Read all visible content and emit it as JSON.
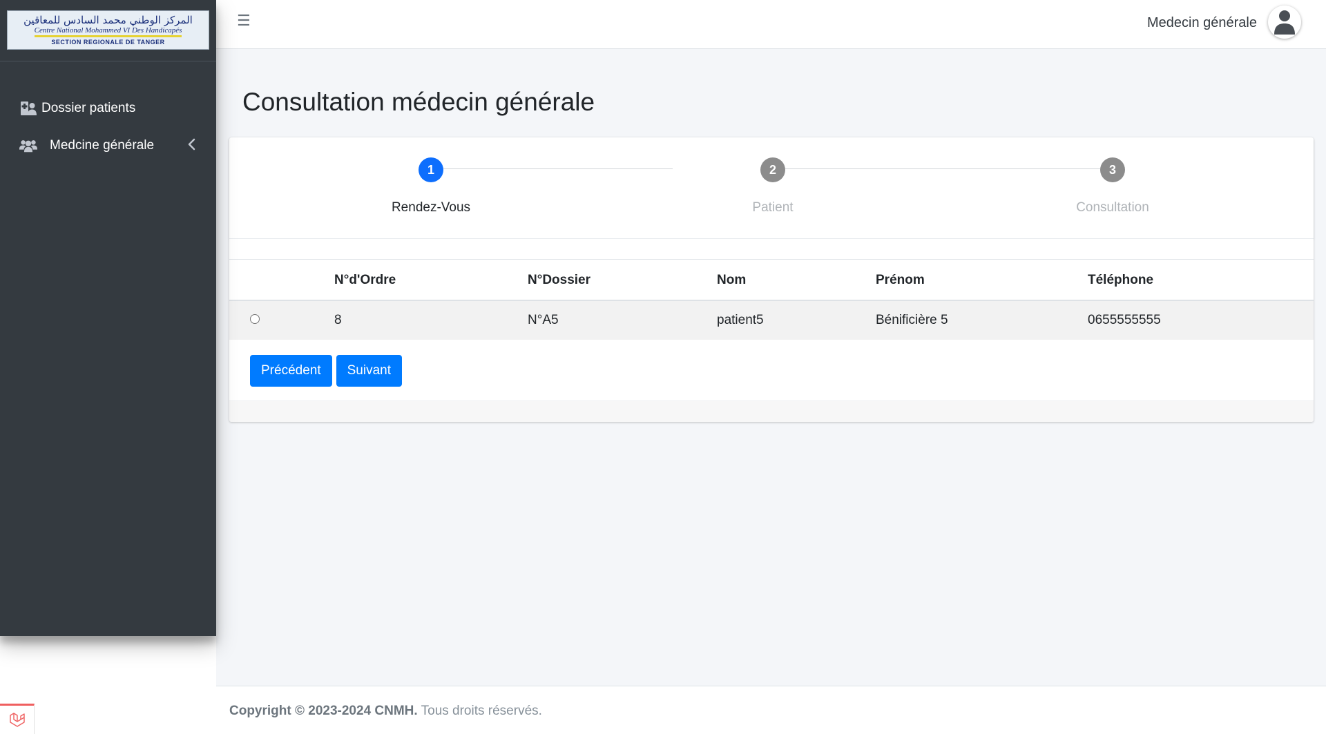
{
  "brand": {
    "logo_arabic": "المركز الوطني محمد السادس للمعاقين",
    "logo_french": "Centre National Mohammed VI Des Handicapés",
    "logo_section": "SECTION REGIONALE DE TANGER"
  },
  "sidebar": {
    "items": [
      {
        "label": "Dossier patients",
        "icon": "hospital-user-icon"
      },
      {
        "label": "Medcine générale",
        "icon": "users-icon"
      }
    ]
  },
  "header": {
    "menu_icon": "☰",
    "user_name": "Medecin générale"
  },
  "page": {
    "title": "Consultation médecin générale"
  },
  "stepper": {
    "steps": [
      {
        "number": "1",
        "label": "Rendez-Vous",
        "active": true
      },
      {
        "number": "2",
        "label": "Patient",
        "active": false
      },
      {
        "number": "3",
        "label": "Consultation",
        "active": false
      }
    ]
  },
  "table": {
    "columns": [
      "",
      "N°d'Ordre",
      "N°Dossier",
      "Nom",
      "Prénom",
      "Téléphone"
    ],
    "rows": [
      [
        "",
        "8",
        "N°A5",
        "patient5",
        "Bénificière 5",
        "0655555555"
      ]
    ]
  },
  "buttons": {
    "previous": "Précédent",
    "next": "Suivant"
  },
  "footer": {
    "copyright": "Copyright © 2023-2024 CNMH.",
    "rights": " Tous droits réservés."
  },
  "colors": {
    "sidebar_bg": "#343a40",
    "primary": "#007bff",
    "step_active": "#0d6efd",
    "step_inactive": "#8c8c8c"
  }
}
